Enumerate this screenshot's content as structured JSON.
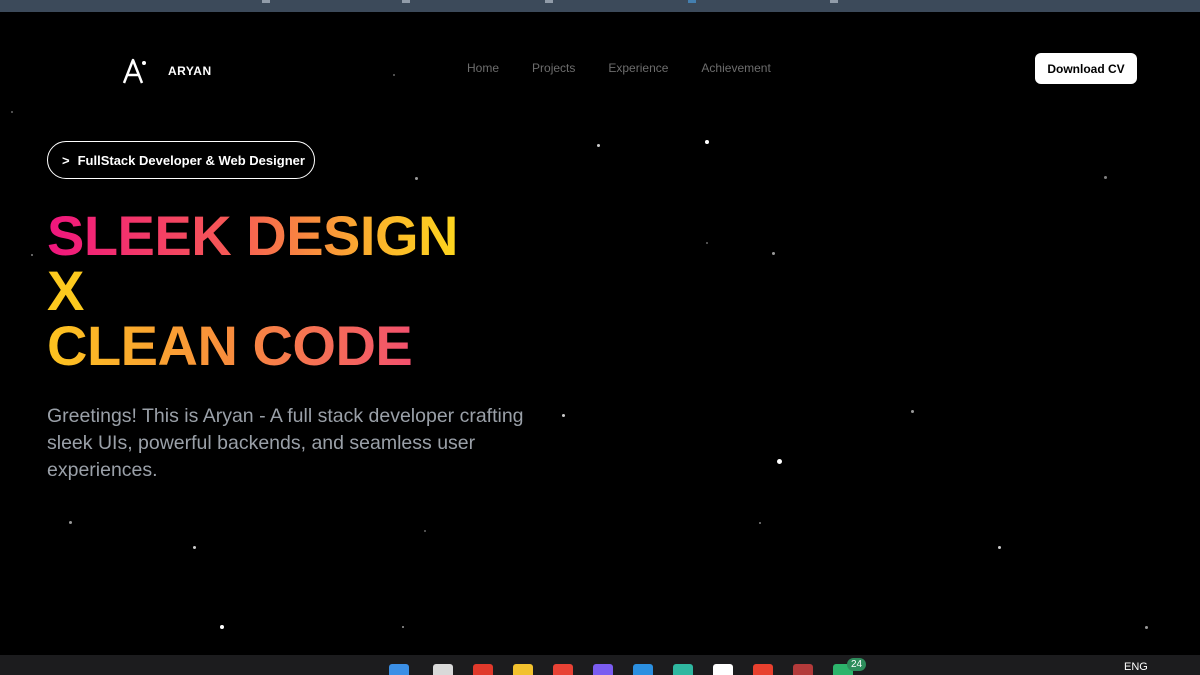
{
  "brand": {
    "name": "ARYAN",
    "logo_icon": "a-logo-icon"
  },
  "nav": {
    "links": [
      "Home",
      "Projects",
      "Experience",
      "Achievement"
    ]
  },
  "header": {
    "cta_label": "Download CV"
  },
  "hero": {
    "role_chevron": ">",
    "role": "FullStack Developer & Web Designer",
    "headline_line1": "SLEEK DESIGN",
    "headline_line2": "X",
    "headline_line3": "CLEAN CODE",
    "bio": "Greetings! This is Aryan - A full stack developer crafting sleek UIs, powerful backends, and seamless user experiences."
  },
  "taskbar": {
    "badge": "24",
    "language": "ENG"
  },
  "colors": {
    "background": "#000000",
    "gradient_pink": "#f0157e",
    "gradient_orange": "#f88c3d",
    "gradient_yellow": "#fdd61e",
    "bio_text": "#9aa0a8",
    "nav_text": "#6d6d6d"
  }
}
